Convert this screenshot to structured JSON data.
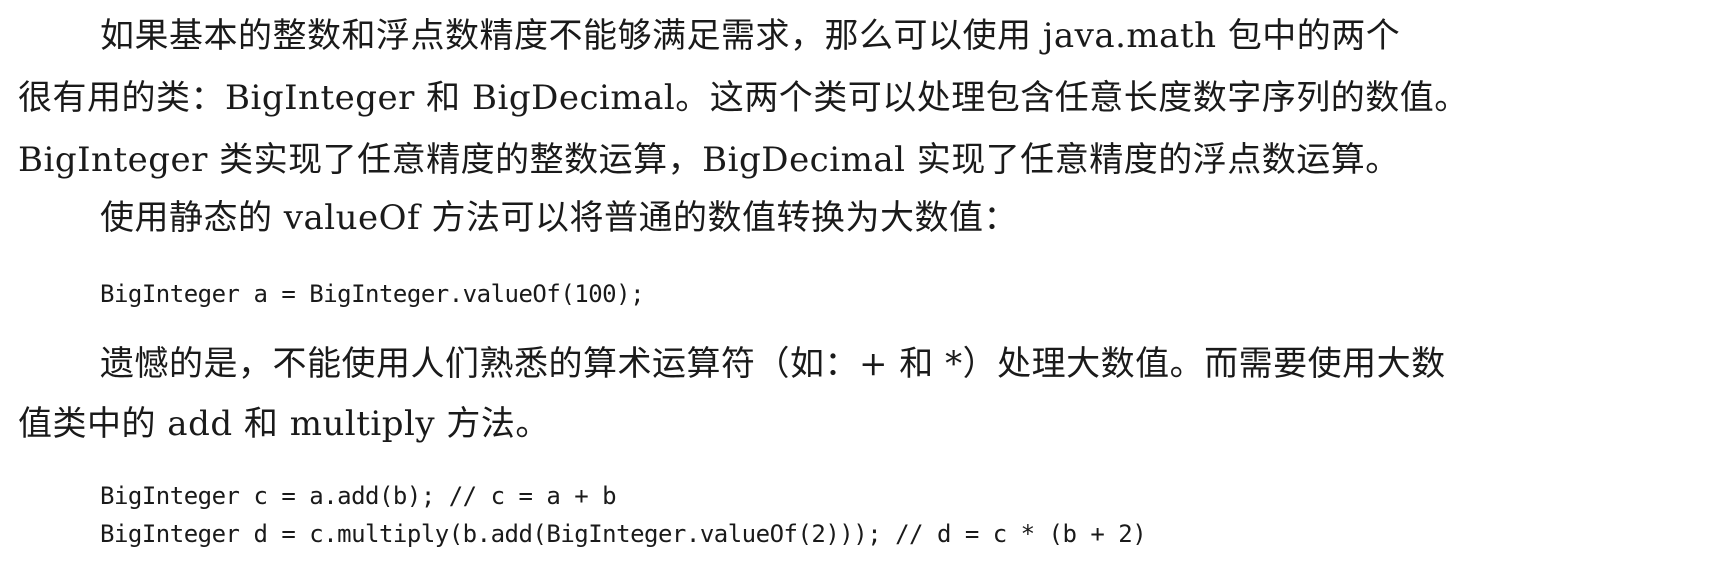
{
  "document": {
    "paragraph_1": {
      "line_1": "如果基本的整数和浮点数精度不能够满足需求，那么可以使用 java.math 包中的两个",
      "line_2": "很有用的类：BigInteger 和 BigDecimal。这两个类可以处理包含任意长度数字序列的数值。",
      "line_3": "BigInteger 类实现了任意精度的整数运算，BigDecimal 实现了任意精度的浮点数运算。"
    },
    "paragraph_2": "使用静态的 valueOf 方法可以将普通的数值转换为大数值：",
    "code_1": "BigInteger a = BigInteger.valueOf(100);",
    "paragraph_3": {
      "line_1": "遗憾的是，不能使用人们熟悉的算术运算符（如：+ 和 *）处理大数值。而需要使用大数",
      "line_2": "值类中的 add 和 multiply 方法。"
    },
    "code_2": [
      "BigInteger c = a.add(b); // c = a + b",
      "BigInteger d = c.multiply(b.add(BigInteger.valueOf(2))); // d = c * (b + 2)"
    ]
  }
}
